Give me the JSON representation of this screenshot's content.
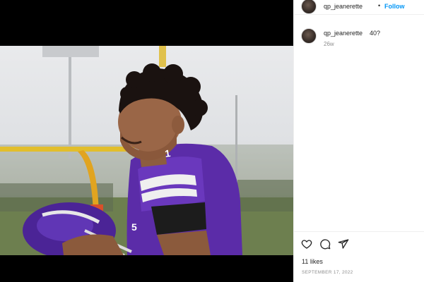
{
  "post": {
    "author": "qp_jeanerette",
    "separator": "•",
    "follow_label": "Follow",
    "likes": "11 likes",
    "date": "SEPTEMBER 17, 2022"
  },
  "comments": [
    {
      "username": "qp_jeanerette",
      "text": "40?",
      "time": "26w"
    }
  ],
  "photo": {
    "jersey_number": "1",
    "sleeve_number": "5"
  },
  "icons": {
    "like": "heart-icon",
    "comment": "comment-icon",
    "share": "share-icon"
  },
  "colors": {
    "accent": "#0095f6",
    "jersey": "#5b2ca8",
    "text": "#262626",
    "muted": "#8e8e8e"
  }
}
